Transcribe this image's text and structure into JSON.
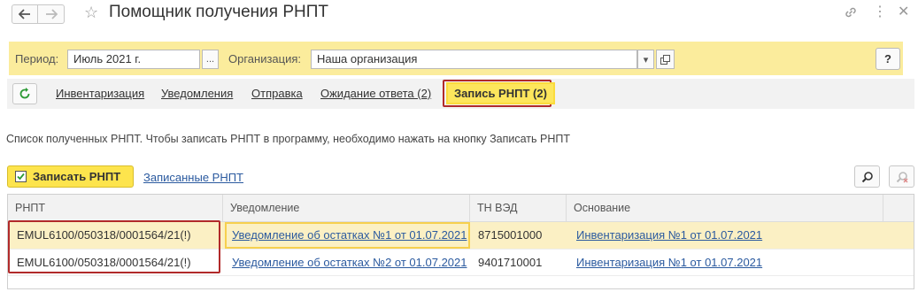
{
  "window": {
    "title": "Помощник получения РНПТ",
    "icons": [
      "back-arrow-icon",
      "forward-arrow-icon",
      "star-icon",
      "link-icon",
      "more-icon",
      "close-icon"
    ]
  },
  "filters": {
    "period_label": "Период:",
    "period_value": "Июль 2021 г.",
    "period_button": "...",
    "org_label": "Организация:",
    "org_value": "Наша организация",
    "help_label": "?"
  },
  "tabs": [
    {
      "label": "Инвентаризация"
    },
    {
      "label": "Уведомления"
    },
    {
      "label": "Отправка"
    },
    {
      "label": "Ожидание ответа (2)"
    },
    {
      "label": "Запись РНПТ (2)",
      "active": true
    }
  ],
  "description": "Список полученных РНПТ. Чтобы записать РНПТ в программу, необходимо нажать на кнопку Записать РНПТ",
  "toolbar": {
    "write_button": "Записать РНПТ",
    "written_link": "Записанные РНПТ"
  },
  "table": {
    "columns": [
      "РНПТ",
      "Уведомление",
      "ТН ВЭД",
      "Основание"
    ],
    "rows": [
      {
        "rnpt": "EMUL6100/050318/0001564/21(!)",
        "notice": "Уведомление об остатках №1 от 01.07.2021",
        "tnved": "8715001000",
        "basis": "Инвентаризация №1 от 01.07.2021"
      },
      {
        "rnpt": "EMUL6100/050318/0001564/21(!)",
        "notice": "Уведомление об остатках №2 от 01.07.2021",
        "tnved": "9401710001",
        "basis": "Инвентаризация №1 от 01.07.2021"
      }
    ]
  },
  "colors": {
    "accent_yellow": "#fde65c",
    "panel_yellow": "#fbec9c",
    "link_blue": "#2b5a9f",
    "highlight_red": "#b12a2a",
    "selected_row": "#fbf0c4"
  }
}
